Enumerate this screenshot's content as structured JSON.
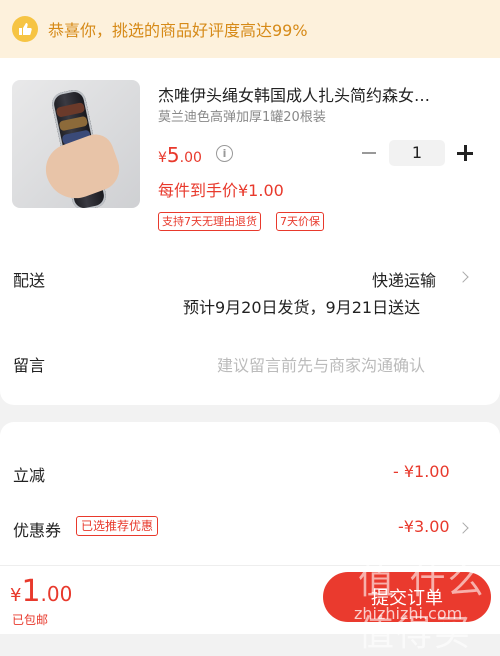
{
  "banner": {
    "text": "恭喜你，挑选的商品好评度高达99%",
    "icon": "thumbs-up-icon"
  },
  "product": {
    "title": "杰唯伊头绳女韩国成人扎头简约森女…",
    "spec": "莫兰迪色高弹加厚1罐20根装",
    "price_symbol": "¥",
    "price_int": "5",
    "price_dec": ".00",
    "quantity": "1",
    "unit_price": "每件到手价¥1.00",
    "tags": [
      "支持7天无理由退货",
      "7天价保"
    ]
  },
  "delivery": {
    "label": "配送",
    "method": "快递运输",
    "eta": "预计9月20日发货，9月21日送达"
  },
  "message": {
    "label": "留言",
    "placeholder": "建议留言前先与商家沟通确认"
  },
  "discount": {
    "label": "立减",
    "value": "- ¥1.00"
  },
  "coupon": {
    "label": "优惠券",
    "tag": "已选推荐优惠",
    "value": "-¥3.00"
  },
  "footer": {
    "total_symbol": "¥",
    "total_int": "1",
    "total_dec": ".00",
    "shipping": "已包邮",
    "submit_label": "提交订单",
    "watermark": "值 什么值得买",
    "watermark_url": "zhizhizhi.com"
  },
  "colors": {
    "accent": "#e8392c",
    "banner_bg": "#fdf1dc",
    "banner_text": "#d68a18"
  }
}
